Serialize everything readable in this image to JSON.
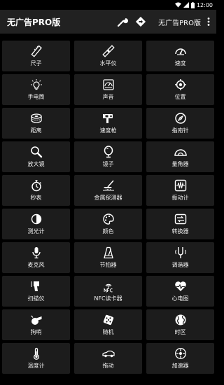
{
  "status_bar": {
    "time": "12:00"
  },
  "app_bar": {
    "title": "无广告PRO版",
    "pro_label": "无广告PRO版",
    "icons": [
      "wrench-icon",
      "diamond-arrow-icon",
      "more-vert-icon"
    ]
  },
  "tools": [
    {
      "label": "尺子",
      "icon": "ruler-icon"
    },
    {
      "label": "水平仪",
      "icon": "level-icon"
    },
    {
      "label": "速度",
      "icon": "speedometer-icon"
    },
    {
      "label": "手电筒",
      "icon": "flashlight-icon"
    },
    {
      "label": "声音",
      "icon": "sound-meter-icon"
    },
    {
      "label": "位置",
      "icon": "location-icon"
    },
    {
      "label": "距离",
      "icon": "distance-icon"
    },
    {
      "label": "速度枪",
      "icon": "speed-gun-icon"
    },
    {
      "label": "指南针",
      "icon": "compass-icon"
    },
    {
      "label": "放大镜",
      "icon": "magnifier-icon"
    },
    {
      "label": "镜子",
      "icon": "mirror-icon"
    },
    {
      "label": "量角器",
      "icon": "protractor-icon"
    },
    {
      "label": "秒表",
      "icon": "stopwatch-icon"
    },
    {
      "label": "金属探测器",
      "icon": "metal-detector-icon"
    },
    {
      "label": "振动计",
      "icon": "vibration-meter-icon"
    },
    {
      "label": "测光计",
      "icon": "light-meter-icon"
    },
    {
      "label": "颜色",
      "icon": "color-icon"
    },
    {
      "label": "转换器",
      "icon": "converter-icon"
    },
    {
      "label": "麦克风",
      "icon": "microphone-icon"
    },
    {
      "label": "节拍器",
      "icon": "metronome-icon"
    },
    {
      "label": "调谐器",
      "icon": "tuner-icon"
    },
    {
      "label": "扫描仪",
      "icon": "scanner-icon"
    },
    {
      "label": "NFC读卡器",
      "icon": "nfc-icon"
    },
    {
      "label": "心电图",
      "icon": "heart-rate-icon"
    },
    {
      "label": "狗哨",
      "icon": "whistle-icon"
    },
    {
      "label": "随机",
      "icon": "dice-icon"
    },
    {
      "label": "时区",
      "icon": "globe-icon"
    },
    {
      "label": "温度计",
      "icon": "thermometer-icon"
    },
    {
      "label": "拖动",
      "icon": "car-icon"
    },
    {
      "label": "加速器",
      "icon": "accelerometer-icon"
    }
  ]
}
